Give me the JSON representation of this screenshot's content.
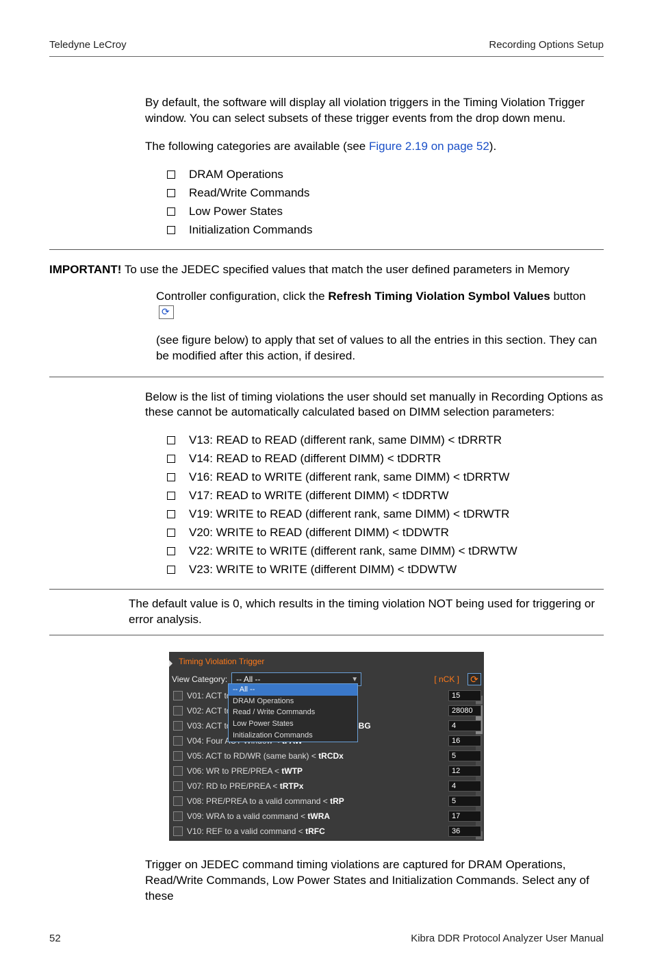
{
  "header": {
    "left": "Teledyne LeCroy",
    "right": "Recording Options Setup"
  },
  "body": {
    "p1": "By default, the software will display all violation triggers in the Timing Violation Trigger window. You can select subsets of these trigger events from the drop down menu.",
    "p2_pre": "The following categories are available (see ",
    "p2_link": "Figure 2.19 on page 52",
    "p2_post": ").",
    "categories": [
      "DRAM Operations",
      "Read/Write Commands",
      "Low Power States",
      "Initialization Commands"
    ],
    "violations_intro": "Below is the list of timing violations the user should set manually in Recording Options as these cannot be automatically calculated based on DIMM selection parameters:",
    "violations": [
      "V13: READ to READ (different rank, same DIMM) < tDRRTR",
      "V14: READ to READ (different DIMM) < tDDRTR",
      "V16: READ to WRITE (different rank, same DIMM) < tDRRTW",
      "V17: READ to WRITE (different DIMM) < tDDRTW",
      "V19: WRITE to READ (different rank, same DIMM) < tDRWTR",
      "V20: WRITE to READ (different DIMM) < tDDWTR",
      "V22: WRITE to WRITE (different rank, same DIMM) < tDRWTW",
      "V23: WRITE to WRITE (different DIMM) < tDDWTW"
    ],
    "default_note": "The default value is 0, which results in the timing violation NOT being used for triggering or error analysis.",
    "closing": "Trigger on JEDEC command timing violations are captured for DRAM Operations, Read/Write Commands, Low Power States and Initialization Commands. Select any of these"
  },
  "important": {
    "label": "IMPORTANT!",
    "line1": "  To use the JEDEC specified values that match the user defined parameters in Memory",
    "line2_pre": "Controller configuration, click the ",
    "line2_bold": "Refresh Timing Violation Symbol Values",
    "line2_post": " button ",
    "line3": "(see figure below) to apply that set of values to all the entries in this section. They can be modified after this action, if desired."
  },
  "widget": {
    "title": "Timing Violation Trigger",
    "view_label": "View Category:",
    "selected": "-- All --",
    "nck": "[ nCK ]",
    "options": [
      "-- All --",
      "DRAM Operations",
      "Read / Write Commands",
      "Low Power States",
      "Initialization Commands"
    ],
    "rows": [
      {
        "label_pre": "V01: ACT to",
        "label_bold": "",
        "value": "15"
      },
      {
        "label_pre": "V02: ACT to",
        "label_bold": "",
        "value": "28080"
      },
      {
        "label_pre": "V03: ACT to ACT (same bank group) < ",
        "label_bold": "tRRD-SBG",
        "value": "4"
      },
      {
        "label_pre": "V04: Four ACT Window < ",
        "label_bold": "tFAW",
        "value": "16"
      },
      {
        "label_pre": "V05: ACT to RD/WR (same bank) < ",
        "label_bold": "tRCDx",
        "value": "5"
      },
      {
        "label_pre": "V06: WR to PRE/PREA < ",
        "label_bold": "tWTP",
        "value": "12"
      },
      {
        "label_pre": "V07: RD to PRE/PREA < ",
        "label_bold": "tRTPx",
        "value": "4"
      },
      {
        "label_pre": "V08: PRE/PREA to a valid command < ",
        "label_bold": "tRP",
        "value": "5"
      },
      {
        "label_pre": "V09: WRA to a valid command < ",
        "label_bold": "tWRA",
        "value": "17"
      },
      {
        "label_pre": "V10: REF to a valid command < ",
        "label_bold": "tRFC",
        "value": "36"
      }
    ]
  },
  "footer": {
    "page": "52",
    "title": "Kibra DDR Protocol Analyzer User Manual"
  }
}
